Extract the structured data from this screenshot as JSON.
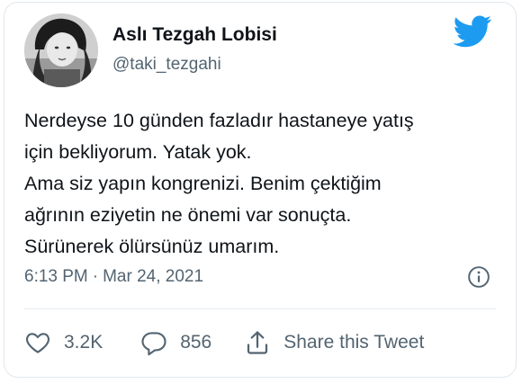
{
  "author": {
    "name": "Aslı Tezgah Lobisi",
    "handle": "@taki_tezgahi",
    "avatar_icon": "profile-photo"
  },
  "brand": {
    "icon": "twitter-bird-icon",
    "color": "#1d9bf0"
  },
  "tweet": {
    "lines": [
      "Nerdeyse 10 günden fazladır hastaneye yatış",
      "için bekliyorum. Yatak yok.",
      "Ama siz yapın kongrenizi. Benim çektiğim",
      "ağrının eziyetin ne önemi var sonuçta.",
      "Sürünerek ölürsünüz umarım."
    ]
  },
  "meta": {
    "time": "6:13 PM",
    "separator": "·",
    "date": "Mar 24, 2021",
    "info_icon": "info-icon"
  },
  "actions": {
    "like_count": "3.2K",
    "reply_count": "856",
    "share_label": "Share this Tweet"
  },
  "colors": {
    "text": "#0f1419",
    "secondary": "#536471",
    "border": "#e1e8ed"
  }
}
